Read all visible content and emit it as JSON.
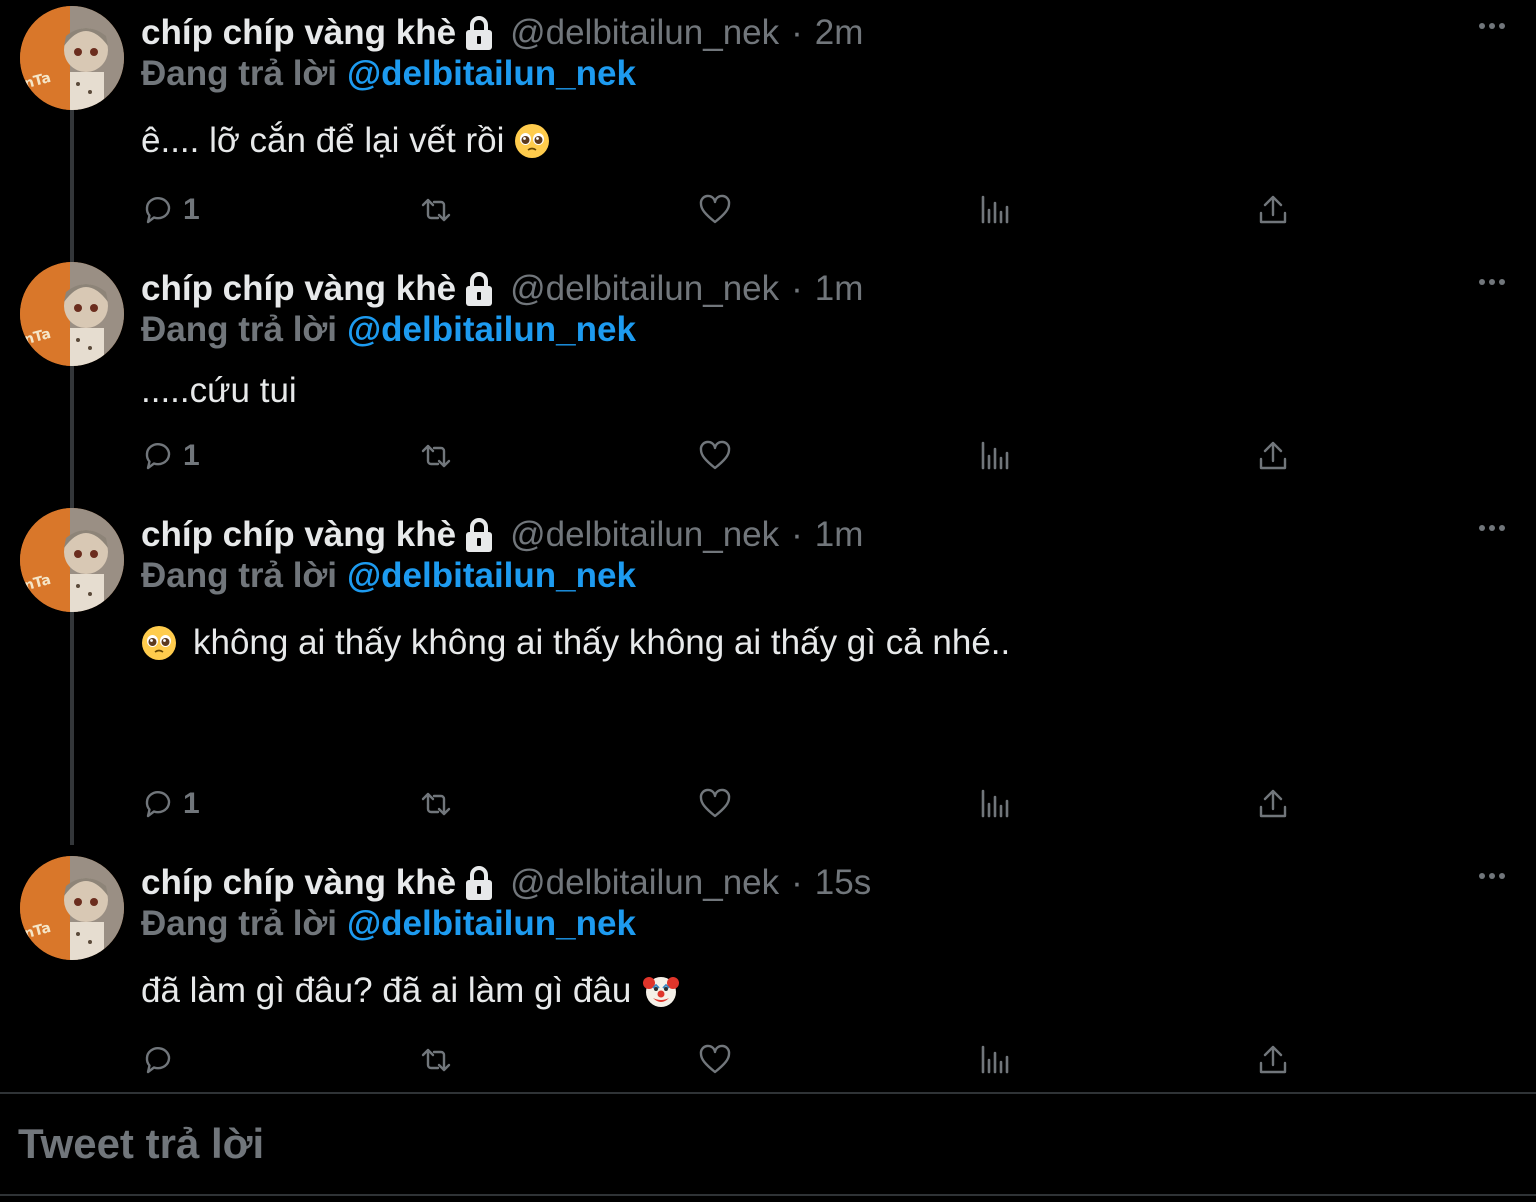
{
  "colors": {
    "background": "#000000",
    "text": "#e7e9ea",
    "muted": "#71767b",
    "accent": "#1d9bf0"
  },
  "tweets": [
    {
      "display_name": "chíp chíp vàng khè",
      "handle": "@delbitailun_nek",
      "separator": "·",
      "time": "2m",
      "reply_label": "Đang trả lời",
      "reply_mention": "@delbitailun_nek",
      "text": "ê.... lỡ cắn để lại vết rồi",
      "emoji": "pleading-face",
      "reply_count": "1"
    },
    {
      "display_name": "chíp chíp vàng khè",
      "handle": "@delbitailun_nek",
      "separator": "·",
      "time": "1m",
      "reply_label": "Đang trả lời",
      "reply_mention": "@delbitailun_nek",
      "text": ".....cứu tui",
      "emoji": "",
      "reply_count": "1"
    },
    {
      "display_name": "chíp chíp vàng khè",
      "handle": "@delbitailun_nek",
      "separator": "·",
      "time": "1m",
      "reply_label": "Đang trả lời",
      "reply_mention": "@delbitailun_nek",
      "text": "không ai thấy không ai thấy không ai thấy gì cả nhé..",
      "emoji": "pleading-face",
      "reply_count": "1"
    },
    {
      "display_name": "chíp chíp vàng khè",
      "handle": "@delbitailun_nek",
      "separator": "·",
      "time": "15s",
      "reply_label": "Đang trả lời",
      "reply_mention": "@delbitailun_nek",
      "text": "đã làm gì đâu? đã ai làm gì đâu",
      "emoji": "clown-face",
      "reply_count": ""
    }
  ],
  "composer": {
    "placeholder": "Tweet trả lời"
  }
}
